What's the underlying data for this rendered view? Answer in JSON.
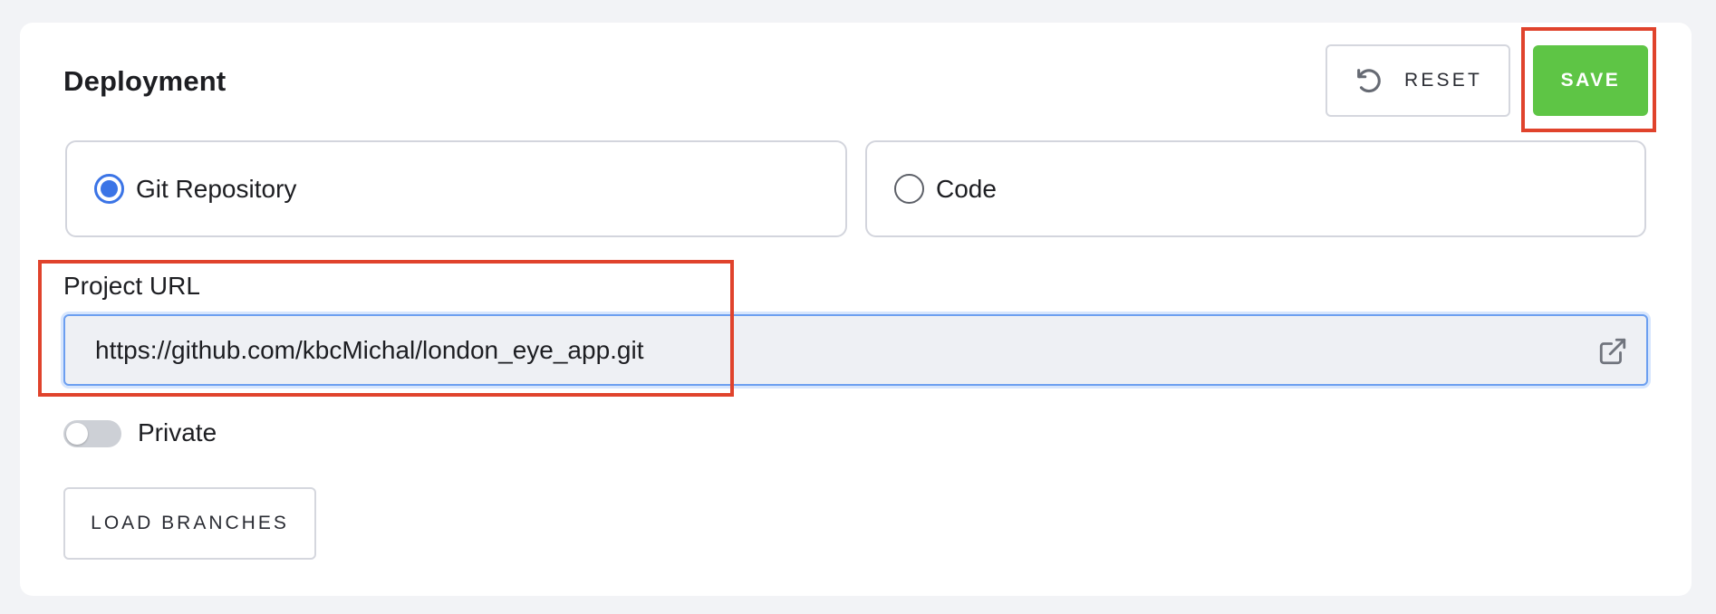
{
  "section": {
    "title": "Deployment"
  },
  "actions": {
    "reset_label": "RESET",
    "save_label": "SAVE",
    "save_color": "#5ec545"
  },
  "source": {
    "options": [
      {
        "label": "Git Repository",
        "selected": true
      },
      {
        "label": "Code",
        "selected": false
      }
    ],
    "accent": "#3b74e6"
  },
  "project_url": {
    "label": "Project URL",
    "value": "https://github.com/kbcMichal/london_eye_app.git",
    "icon": "external-link-icon"
  },
  "private_toggle": {
    "label": "Private",
    "on": false
  },
  "load_branches_label": "LOAD BRANCHES",
  "highlight_color": "#e0432c"
}
